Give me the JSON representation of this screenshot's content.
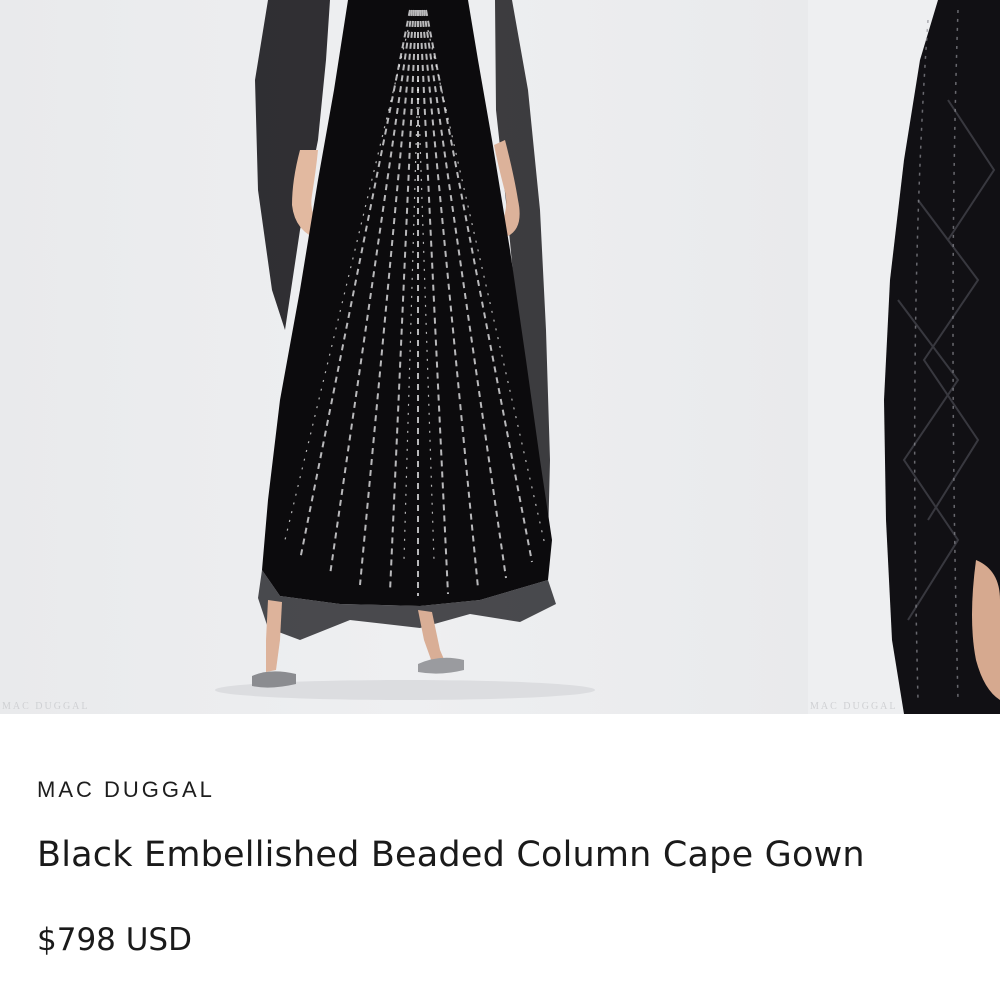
{
  "gallery": {
    "images": [
      {
        "icon": "product-photo-full-length",
        "watermark": "MAC DUGGAL"
      },
      {
        "icon": "product-photo-detail",
        "watermark": "MAC DUGGAL"
      }
    ]
  },
  "product": {
    "brand": "MAC DUGGAL",
    "title": "Black Embellished Beaded Column Cape Gown",
    "price": "$798 USD"
  },
  "colors": {
    "gallery_bg": "#ebecee",
    "gown": "#0c0b0d",
    "beads": "#d8d8da",
    "text": "#1a1a1a"
  }
}
